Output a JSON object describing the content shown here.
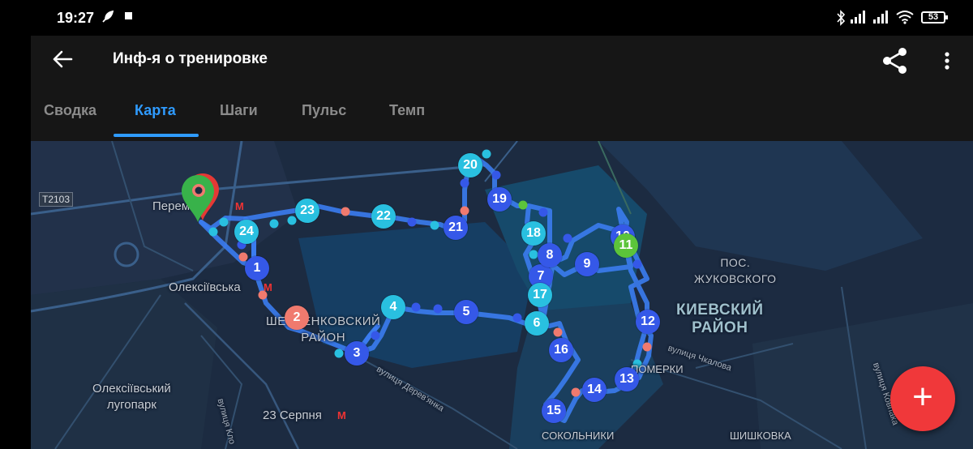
{
  "status_bar": {
    "time": "19:27",
    "battery": "53",
    "icons": [
      "feather-icon",
      "square-icon",
      "bluetooth-icon",
      "signal-icon",
      "signal-icon",
      "wifi-icon"
    ]
  },
  "app_bar": {
    "title": "Инф-я о тренировке",
    "back_icon": "arrow-left-icon",
    "share_icon": "share-icon",
    "more_icon": "more-vertical-icon"
  },
  "tabs": [
    {
      "label": "Сводка",
      "active": false
    },
    {
      "label": "Карта",
      "active": true
    },
    {
      "label": "Шаги",
      "active": false
    },
    {
      "label": "Пульс",
      "active": false
    },
    {
      "label": "Темп",
      "active": false
    }
  ],
  "colors": {
    "accent": "#2f9bff",
    "route": "#3b7cf0",
    "marker_blue": "#3558e8",
    "marker_cyan": "#29c0e0",
    "marker_salmon": "#f07a6e",
    "marker_green": "#5cc43a",
    "fab": "#f0383a"
  },
  "map": {
    "road_badge": "T2103",
    "labels": {
      "peremoga": "Перемога",
      "oleksiivska": "Олексіївська",
      "district_shev": [
        "ШЕВЧЕНКОВСКИЙ",
        "РАЙОН"
      ],
      "district_kiev": [
        "КИЕВСКИЙ",
        "РАЙОН"
      ],
      "pos": [
        "ПОС.",
        "ЖУКОВСКОГО"
      ],
      "park": [
        "Олексіївський",
        "лугопарк"
      ],
      "serpnya": "23 Серпня",
      "pomerki": "ПОМЕРКИ",
      "sokolniki": "СОКОЛЬНИКИ",
      "shishkovka": "ШИШКОВКА",
      "street_derev": "вулиця Дерев'янка",
      "street_chkalova": "вулиця Чкалова",
      "street_kovpaka": "вулиця Ковпака",
      "street_klo": "вулиця Кло"
    },
    "metro_symbol": "М",
    "markers": [
      {
        "label": "1",
        "color": "blue"
      },
      {
        "label": "2",
        "color": "salmon"
      },
      {
        "label": "3",
        "color": "blue"
      },
      {
        "label": "4",
        "color": "cyan"
      },
      {
        "label": "5",
        "color": "blue"
      },
      {
        "label": "6",
        "color": "cyan"
      },
      {
        "label": "7",
        "color": "blue"
      },
      {
        "label": "8",
        "color": "blue"
      },
      {
        "label": "9",
        "color": "blue"
      },
      {
        "label": "10",
        "color": "blue"
      },
      {
        "label": "11",
        "color": "green"
      },
      {
        "label": "12",
        "color": "blue"
      },
      {
        "label": "13",
        "color": "blue"
      },
      {
        "label": "14",
        "color": "blue"
      },
      {
        "label": "15",
        "color": "blue"
      },
      {
        "label": "16",
        "color": "blue"
      },
      {
        "label": "17",
        "color": "cyan"
      },
      {
        "label": "18",
        "color": "cyan"
      },
      {
        "label": "19",
        "color": "blue"
      },
      {
        "label": "20",
        "color": "cyan"
      },
      {
        "label": "21",
        "color": "blue"
      },
      {
        "label": "22",
        "color": "cyan"
      },
      {
        "label": "23",
        "color": "cyan"
      },
      {
        "label": "24",
        "color": "cyan"
      }
    ],
    "start_pin_icon": "location-pin-icon"
  },
  "fab": {
    "label": "+",
    "icon": "plus-icon"
  }
}
